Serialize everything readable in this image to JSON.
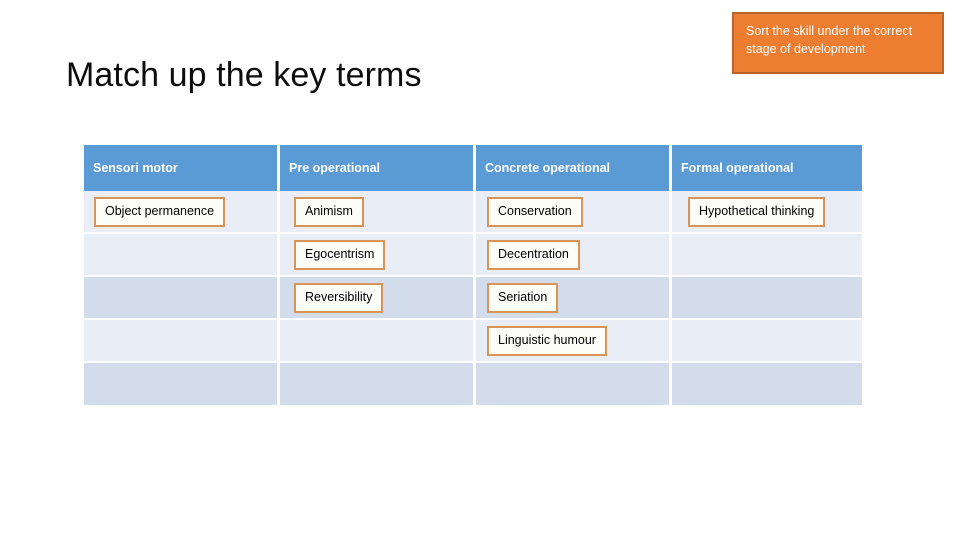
{
  "slide": {
    "title": "Match up the key terms",
    "background_color": "#ffffff"
  },
  "instruction": {
    "text": "Sort the skill under the correct stage of development",
    "fill_color": "#ED7D31",
    "border_color": "#B9642A",
    "text_color": "#ffffff"
  },
  "table": {
    "header_fill": "#5B9BD5",
    "header_text_color": "#ffffff",
    "band_light": "#E9EDF5",
    "band_dark": "#D2DCEA",
    "chip_border_color": "#D99559",
    "chip_fill": "#FDFDF8",
    "headers": [
      "Sensori motor",
      "Pre operational",
      "Concrete operational",
      "Formal operational"
    ],
    "rows": [
      {
        "band": "light",
        "cells": [
          "Object permanence",
          "Animism",
          "Conservation",
          "Hypothetical thinking"
        ]
      },
      {
        "band": "light",
        "cells": [
          "",
          "Egocentrism",
          "Decentration",
          ""
        ]
      },
      {
        "band": "dark",
        "cells": [
          "",
          "Reversibility",
          "Seriation",
          ""
        ]
      },
      {
        "band": "light",
        "cells": [
          "",
          "",
          "Linguistic humour",
          ""
        ]
      },
      {
        "band": "dark",
        "cells": [
          "",
          "",
          "",
          ""
        ]
      }
    ]
  }
}
